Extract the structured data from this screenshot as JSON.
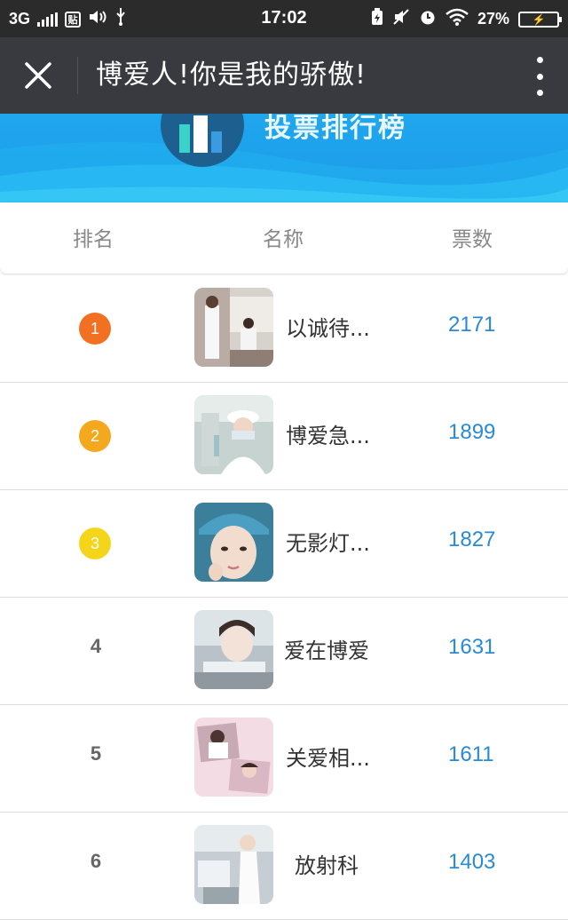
{
  "status_bar": {
    "network": "3G",
    "notify_glyph": "贴",
    "time": "17:02",
    "battery": "27%"
  },
  "title_bar": {
    "title": "博爱人!你是我的骄傲!"
  },
  "banner": {
    "title": "投票排行榜"
  },
  "table": {
    "headers": {
      "rank": "排名",
      "name": "名称",
      "votes": "票数"
    },
    "rows": [
      {
        "rank": "1",
        "name": "以诚待...",
        "votes": "2171"
      },
      {
        "rank": "2",
        "name": "博爱急...",
        "votes": "1899"
      },
      {
        "rank": "3",
        "name": "无影灯...",
        "votes": "1827"
      },
      {
        "rank": "4",
        "name": "爱在博爱",
        "votes": "1631"
      },
      {
        "rank": "5",
        "name": "关爱相...",
        "votes": "1611"
      },
      {
        "rank": "6",
        "name": "放射科",
        "votes": "1403"
      }
    ]
  },
  "colors": {
    "rank1": "#f27022",
    "rank2": "#f4a81d",
    "rank3": "#f5d51a",
    "votes": "#2a8ad6",
    "banner": "#1fa7ee",
    "title_bar": "#393a3f"
  },
  "icons": [
    "close-icon",
    "more-vertical-icon",
    "signal-icon",
    "volume-icon",
    "usb-icon",
    "battery-icon",
    "wifi-icon",
    "alarm-icon",
    "mute-icon",
    "podium-icon"
  ]
}
